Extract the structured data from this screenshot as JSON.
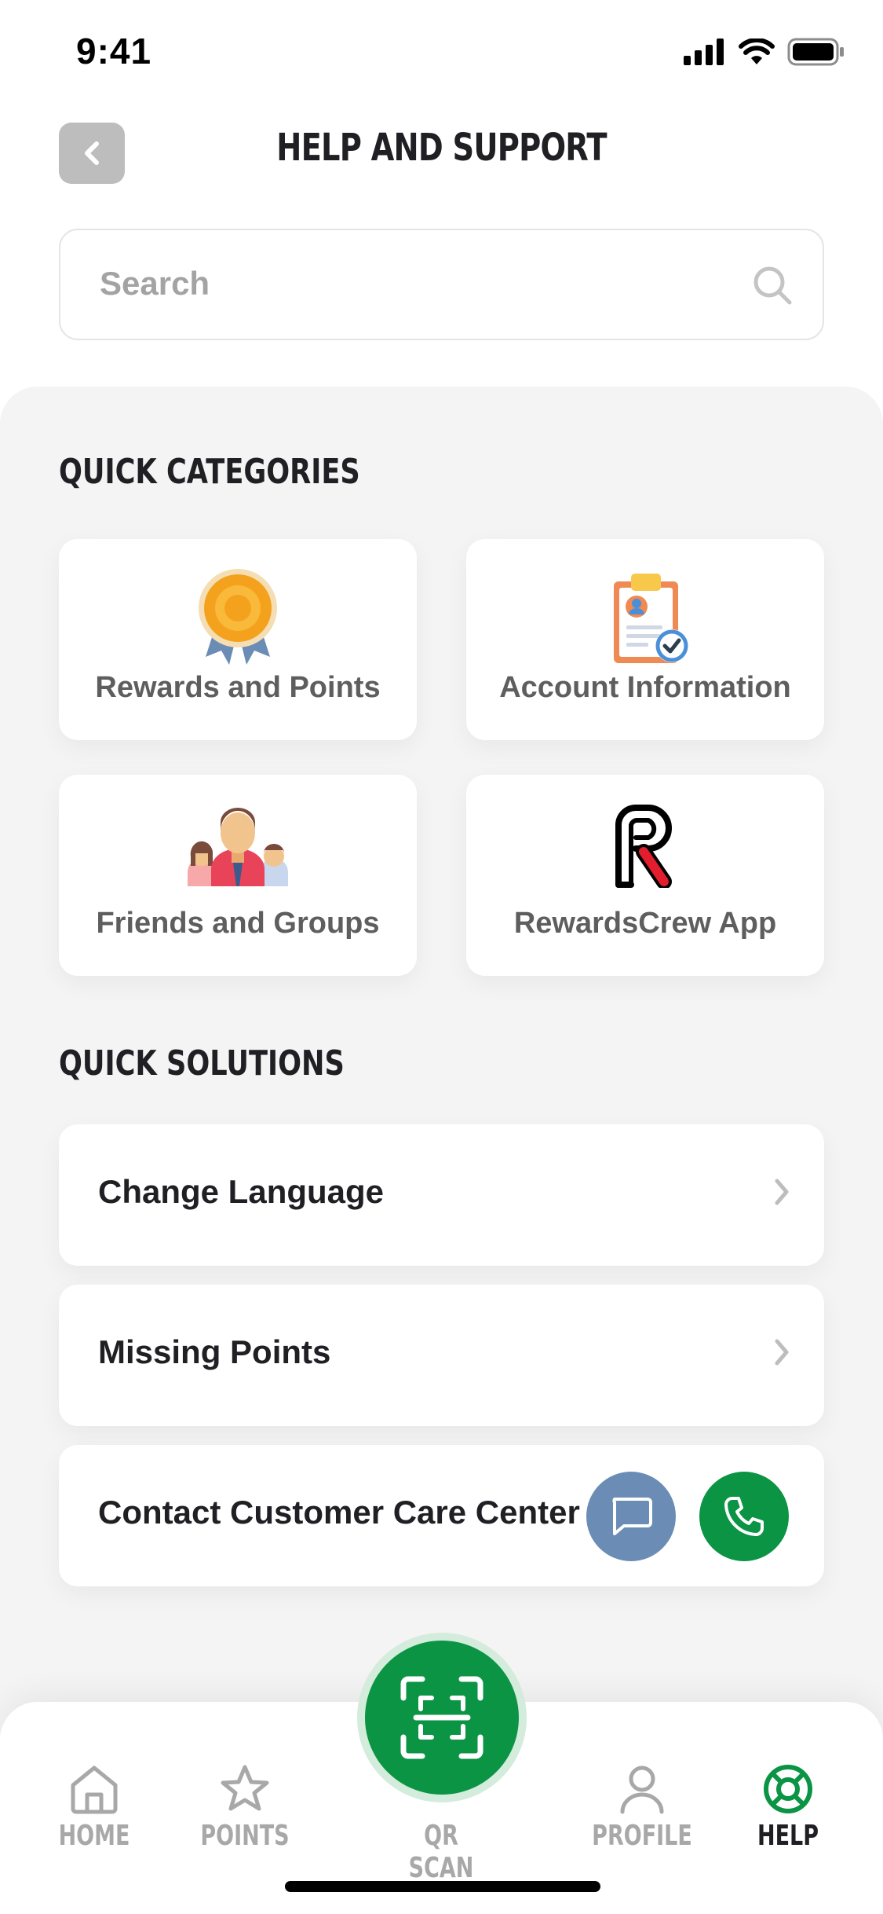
{
  "status_bar": {
    "time": "9:41"
  },
  "header": {
    "title": "HELP AND SUPPORT",
    "back_icon": "chevron-left-icon"
  },
  "search": {
    "placeholder": "Search",
    "icon": "search-icon"
  },
  "quick_categories": {
    "title": "QUICK CATEGORIES",
    "items": [
      {
        "label": "Rewards and Points",
        "icon": "medal-icon"
      },
      {
        "label": "Account Information",
        "icon": "clipboard-icon"
      },
      {
        "label": "Friends and Groups",
        "icon": "people-icon"
      },
      {
        "label": "RewardsCrew App",
        "icon": "rewardscrew-logo-icon"
      }
    ]
  },
  "quick_solutions": {
    "title": "QUICK SOLUTIONS",
    "items": [
      {
        "label": "Change Language"
      },
      {
        "label": "Missing Points"
      },
      {
        "label": "Contact Customer Care Center"
      }
    ]
  },
  "tab_bar": {
    "items": [
      {
        "label": "HOME",
        "icon": "home-icon",
        "active": false
      },
      {
        "label": "POINTS",
        "icon": "star-icon",
        "active": false
      },
      {
        "label": "QR SCAN",
        "icon": "qr-scan-icon",
        "active": false
      },
      {
        "label": "PROFILE",
        "icon": "person-icon",
        "active": false
      },
      {
        "label": "HELP",
        "icon": "lifebuoy-icon",
        "active": true
      }
    ]
  },
  "colors": {
    "brand_green": "#0a9444",
    "chat_blue": "#6b8db5",
    "panel_background": "#f4f4f4"
  }
}
